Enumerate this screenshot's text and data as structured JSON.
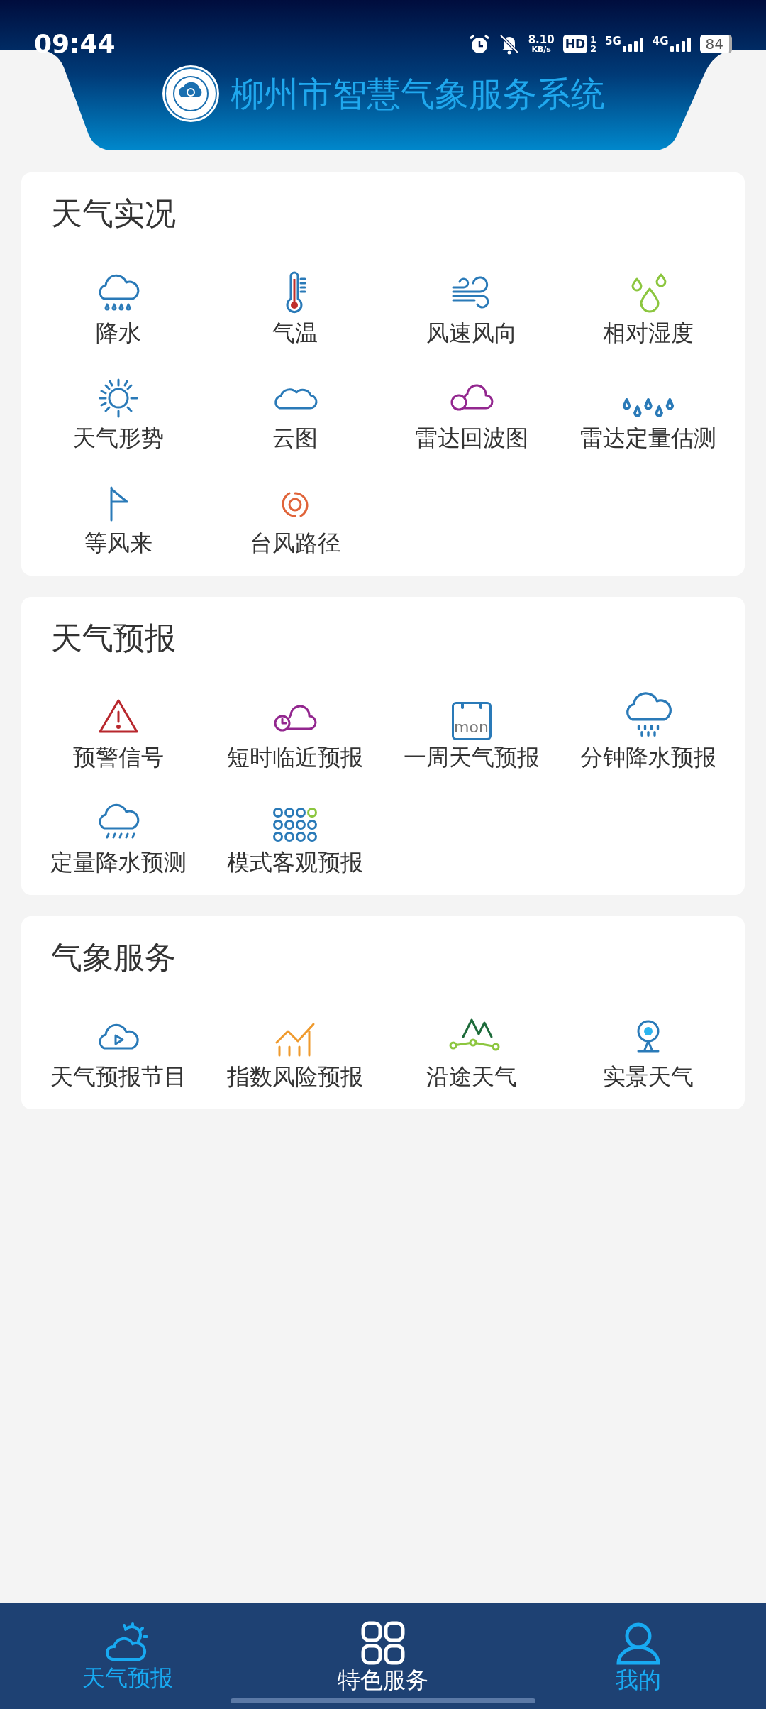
{
  "status_bar": {
    "time": "09:44",
    "speed_value": "8.10",
    "speed_unit": "KB/s",
    "hd": "HD",
    "sim_1": "1",
    "sim_2": "2",
    "network_1": "5G",
    "network_2": "4G",
    "battery": "84"
  },
  "header": {
    "title": "柳州市智慧气象服务系统"
  },
  "sections": [
    {
      "title": "天气实况",
      "items": [
        "降水",
        "气温",
        "风速风向",
        "相对湿度",
        "天气形势",
        "云图",
        "雷达回波图",
        "雷达定量估测",
        "等风来",
        "台风路径"
      ]
    },
    {
      "title": "天气预报",
      "items": [
        "预警信号",
        "短时临近预报",
        "一周天气预报",
        "分钟降水预报",
        "定量降水预测",
        "模式客观预报"
      ]
    },
    {
      "title": "气象服务",
      "items": [
        "天气预报节目",
        "指数风险预报",
        "沿途天气",
        "实景天气"
      ]
    }
  ],
  "calendar_icon_text": "mon",
  "bottom_nav": [
    {
      "label": "天气预报",
      "selected": false
    },
    {
      "label": "特色服务",
      "selected": true
    },
    {
      "label": "我的",
      "selected": false
    }
  ]
}
